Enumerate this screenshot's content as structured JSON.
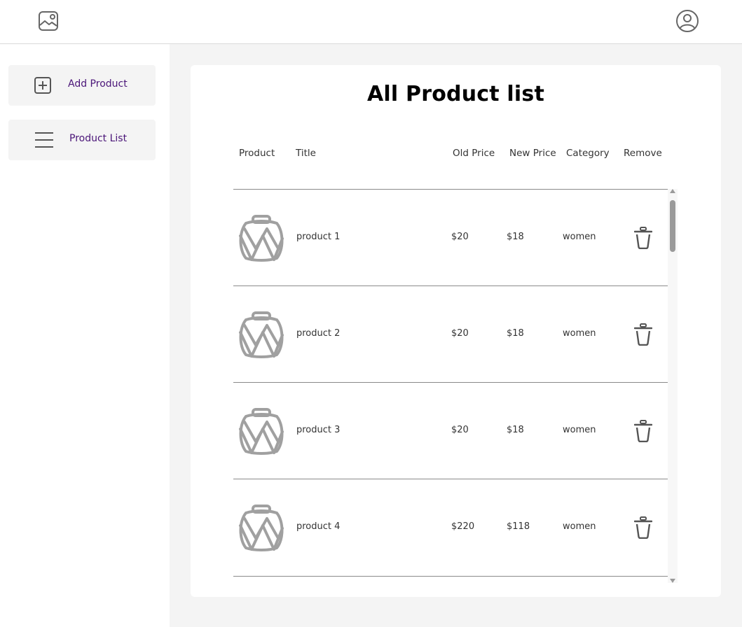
{
  "colors": {
    "accent_text": "#4a1578",
    "page_bg": "#f4f4f4",
    "card_bg": "#ffffff",
    "divider": "#8a8a8a"
  },
  "header": {
    "logo_icon": "image-icon",
    "profile_icon": "user-circle-icon"
  },
  "sidebar": {
    "items": [
      {
        "label": "Add Product",
        "icon": "plus-square-icon"
      },
      {
        "label": "Product List",
        "icon": "menu-lines-icon"
      }
    ]
  },
  "main": {
    "title": "All Product list",
    "columns": [
      "Product",
      "Title",
      "Old Price",
      "New Price",
      "Category",
      "Remove"
    ],
    "rows": [
      {
        "title": "product 1",
        "old_price": "$20",
        "new_price": "$18",
        "category": "women"
      },
      {
        "title": "product 2",
        "old_price": "$20",
        "new_price": "$18",
        "category": "women"
      },
      {
        "title": "product 3",
        "old_price": "$20",
        "new_price": "$18",
        "category": "women"
      },
      {
        "title": "product 4",
        "old_price": "$220",
        "new_price": "$118",
        "category": "women"
      }
    ]
  }
}
